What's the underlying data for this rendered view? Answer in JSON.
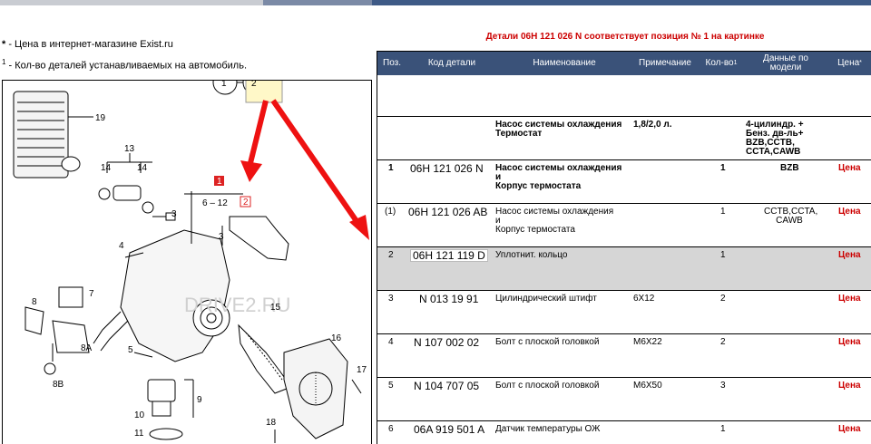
{
  "notes": {
    "price_marker": "*",
    "price_text": " - Цена в интернет-магазине Exist.ru",
    "qty_marker": "1",
    "qty_text": " - Кол-во деталей устанавливаемых на автомобиль."
  },
  "position_header": "Детали 06H 121 026 N соответствует позиция № 1 на картинке",
  "table": {
    "columns": {
      "pos": "Поз.",
      "code": "Код детали",
      "name": "Наименование",
      "note": "Примечание",
      "qty": "Кол-во",
      "qty_sup": "1",
      "model": "Данные по модели",
      "price": "Цена",
      "price_sup": "*"
    },
    "group": {
      "name": "Насос системы охлаждения\nТермостат",
      "note": "1,8/2,0 л.",
      "model": "4-цилиндр. +\nБенз. дв-ль+\nBZB,CCTB,\nCCTA,CAWB"
    },
    "rows": [
      {
        "pos": "1",
        "code": "06H 121 026 N",
        "name": "Насос системы охлаждения\nи\nКорпус термостата",
        "note": "",
        "qty": "1",
        "model": "BZB",
        "price": "Цена"
      },
      {
        "pos": "(1)",
        "code": "06H 121 026 AB",
        "name": "Насос системы охлаждения\nи\nКорпус термостата",
        "note": "",
        "qty": "1",
        "model": "CCTB,CCTA,\nCAWB",
        "price": "Цена"
      },
      {
        "pos": "2",
        "code": "06H 121 119 D",
        "name": "Уплотнит. кольцо",
        "note": "",
        "qty": "1",
        "model": "",
        "price": "Цена"
      },
      {
        "pos": "3",
        "code": "N  013 19 91",
        "name": "Цилиндрический штифт",
        "note": "6X12",
        "qty": "2",
        "model": "",
        "price": "Цена"
      },
      {
        "pos": "4",
        "code": "N  107 002 02",
        "name": "Болт с плоской головкой",
        "note": "M6X22",
        "qty": "2",
        "model": "",
        "price": "Цена"
      },
      {
        "pos": "5",
        "code": "N  104 707 05",
        "name": "Болт с плоской головкой",
        "note": "M6X50",
        "qty": "3",
        "model": "",
        "price": "Цена"
      },
      {
        "pos": "6",
        "code": "06A 919 501 A",
        "name": "Датчик температуры ОЖ",
        "note": "",
        "qty": "1",
        "model": "",
        "price": "Цена"
      }
    ]
  },
  "diagram": {
    "callouts": [
      "1",
      "2",
      "3",
      "4",
      "5",
      "6 – 12",
      "7",
      "8",
      "8A",
      "8B",
      "9",
      "10",
      "11",
      "13",
      "14",
      "14",
      "15",
      "16",
      "17",
      "18",
      "19",
      "3",
      "1",
      "2"
    ],
    "watermark": "DRIVE2.RU",
    "accent_color": "#ee1111"
  }
}
